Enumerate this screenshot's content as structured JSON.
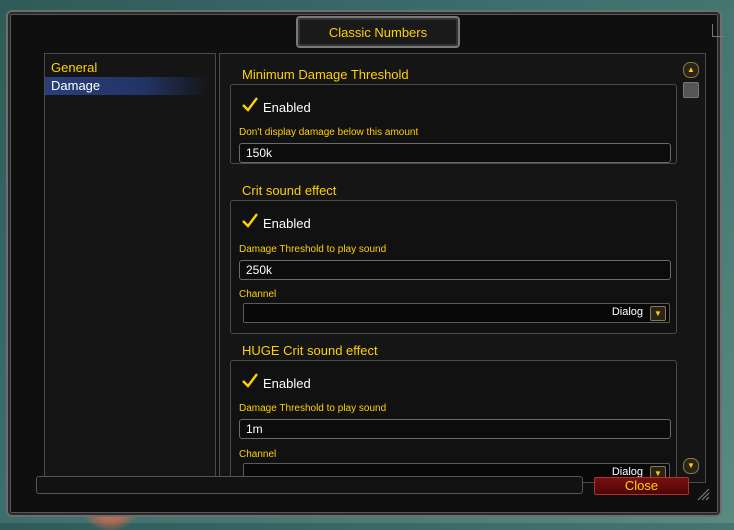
{
  "window": {
    "title": "Classic Numbers"
  },
  "sidebar": {
    "items": [
      {
        "label": "General"
      },
      {
        "label": "Damage"
      }
    ]
  },
  "sections": [
    {
      "header": "Minimum Damage Threshold",
      "enabled_label": "Enabled",
      "enabled": true,
      "field_label": "Don't display damage below this amount",
      "field_value": "150k"
    },
    {
      "header": "Crit sound effect",
      "enabled_label": "Enabled",
      "enabled": true,
      "field_label": "Damage Threshold to play sound",
      "field_value": "250k",
      "channel_label": "Channel",
      "channel_value": "Dialog"
    },
    {
      "header": "HUGE Crit sound effect",
      "enabled_label": "Enabled",
      "enabled": true,
      "field_label": "Damage Threshold to play sound",
      "field_value": "1m",
      "channel_label": "Channel",
      "channel_value": "Dialog"
    }
  ],
  "footer": {
    "close_label": "Close"
  },
  "colors": {
    "accent": "#ffd100",
    "selected_bg": "#2a3f7a",
    "close_bg": "#7a0f0f"
  }
}
